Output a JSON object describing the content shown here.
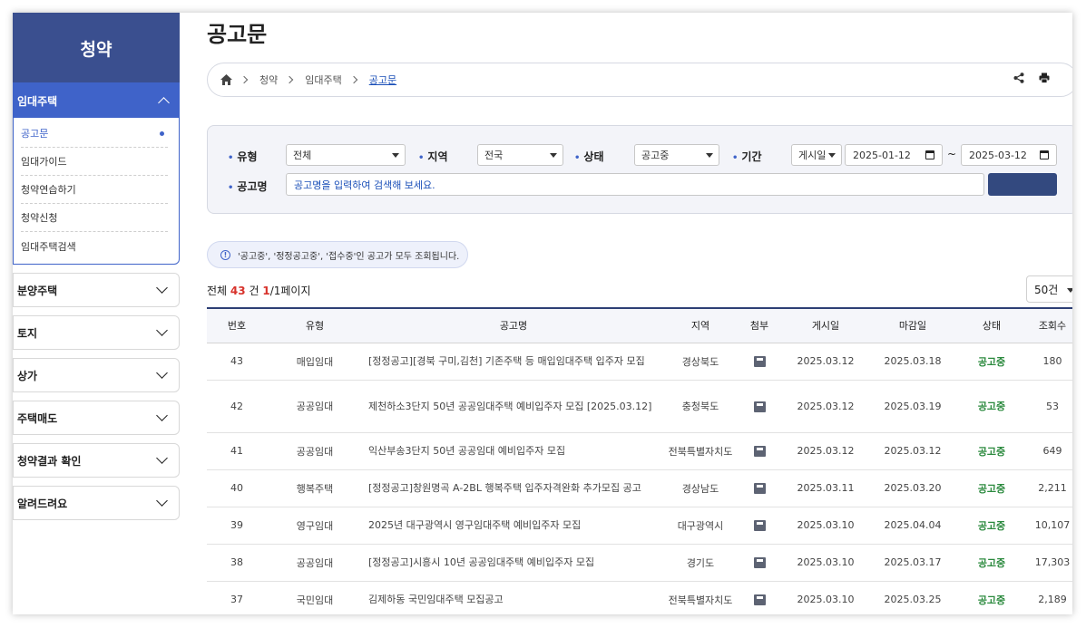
{
  "sidebar": {
    "title": "청약",
    "open_menu": "임대주택",
    "sub_items": [
      {
        "label": "공고문",
        "active": true
      },
      {
        "label": "임대가이드",
        "active": false
      },
      {
        "label": "청약연습하기",
        "active": false
      },
      {
        "label": "청약신청",
        "active": false
      },
      {
        "label": "임대주택검색",
        "active": false
      }
    ],
    "closed_menus": [
      "분양주택",
      "토지",
      "상가",
      "주택매도",
      "청약결과 확인",
      "알려드려요"
    ]
  },
  "page_title": "공고문",
  "breadcrumb": {
    "items": [
      "청약",
      "임대주택"
    ],
    "current": "공고문",
    "tools": [
      "share-icon",
      "print-icon"
    ]
  },
  "search": {
    "type_label": "유형",
    "type_value": "전체",
    "region_label": "지역",
    "region_value": "전국",
    "status_label": "상태",
    "status_value": "공고중",
    "period_label": "기간",
    "period_type": "게시일",
    "date_from": "2025-01-12",
    "date_sep": "~",
    "date_to": "2025-03-12",
    "keyword_label": "공고명",
    "keyword_placeholder": "공고명을 입력하여 검색해 보세요.",
    "button_label": ""
  },
  "notice": "'공고중', '정정공고중', '접수중'인 공고가 모두 조회됩니다.",
  "summary": {
    "prefix": "전체",
    "count": "43",
    "unit": "건",
    "page": "1",
    "page_rest": "/1페이지"
  },
  "per_page": "50건",
  "table": {
    "columns": [
      "번호",
      "유형",
      "공고명",
      "지역",
      "첨부",
      "게시일",
      "마감일",
      "상태",
      "조회수"
    ],
    "rows": [
      {
        "no": "43",
        "type": "매입임대",
        "title": "[정정공고][경북 구미,김천] 기존주택 등 매입임대주택 입주자 모집",
        "region": "경상북도",
        "posted": "2025.03.12",
        "deadline": "2025.03.18",
        "status": "공고중",
        "views": "180"
      },
      {
        "no": "42",
        "type": "공공임대",
        "title": "제천하소3단지 50년 공공임대주택 예비입주자 모집 [2025.03.12]",
        "region": "충청북도",
        "posted": "2025.03.12",
        "deadline": "2025.03.19",
        "status": "공고중",
        "views": "53"
      },
      {
        "no": "41",
        "type": "공공임대",
        "title": "익산부송3단지 50년 공공임대 예비입주자 모집",
        "region": "전북특별자치도",
        "posted": "2025.03.12",
        "deadline": "2025.03.12",
        "status": "공고중",
        "views": "649"
      },
      {
        "no": "40",
        "type": "행복주택",
        "title": "[정정공고]창원명곡 A-2BL 행복주택 입주자격완화 추가모집 공고",
        "region": "경상남도",
        "posted": "2025.03.11",
        "deadline": "2025.03.20",
        "status": "공고중",
        "views": "2,211"
      },
      {
        "no": "39",
        "type": "영구임대",
        "title": "2025년 대구광역시 영구임대주택 예비입주자 모집",
        "region": "대구광역시",
        "posted": "2025.03.10",
        "deadline": "2025.04.04",
        "status": "공고중",
        "views": "10,107"
      },
      {
        "no": "38",
        "type": "공공임대",
        "title": "[정정공고]시흥시 10년 공공임대주택 예비입주자 모집",
        "region": "경기도",
        "posted": "2025.03.10",
        "deadline": "2025.03.17",
        "status": "공고중",
        "views": "17,303"
      },
      {
        "no": "37",
        "type": "국민임대",
        "title": "김제하동 국민임대주택 모집공고",
        "region": "전북특별자치도",
        "posted": "2025.03.10",
        "deadline": "2025.03.25",
        "status": "공고중",
        "views": "2,189"
      }
    ]
  }
}
